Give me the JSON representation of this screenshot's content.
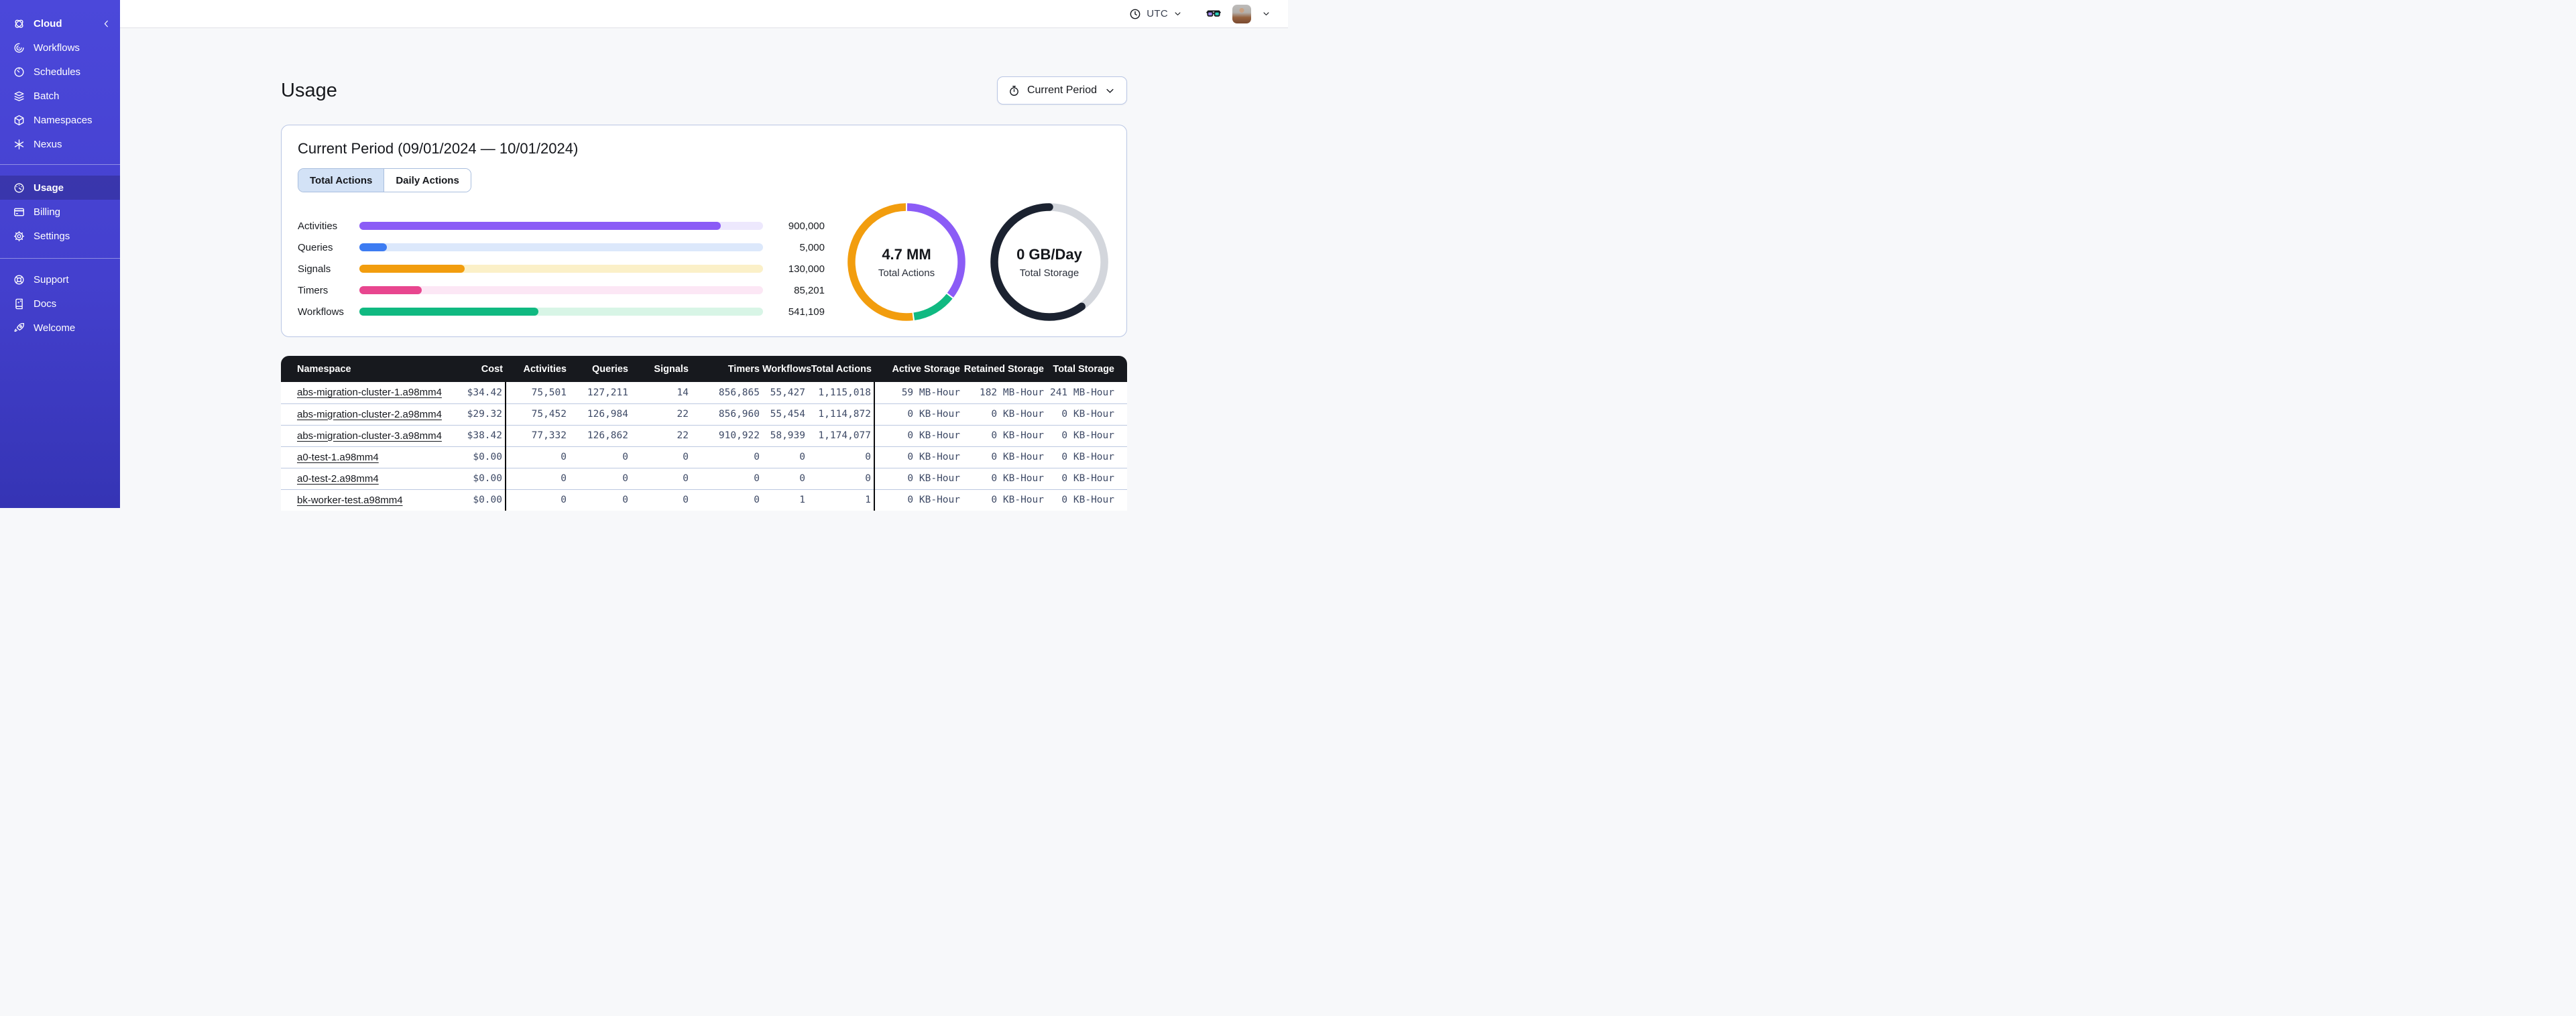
{
  "sidebar": {
    "header": {
      "label": "Cloud",
      "icon": "temporal-logo",
      "collapse_icon": "chevron-left"
    },
    "sections": [
      {
        "items": [
          {
            "label": "Workflows",
            "icon": "workflows"
          },
          {
            "label": "Schedules",
            "icon": "schedules"
          },
          {
            "label": "Batch",
            "icon": "batch"
          },
          {
            "label": "Namespaces",
            "icon": "namespaces"
          },
          {
            "label": "Nexus",
            "icon": "nexus"
          }
        ]
      },
      {
        "items": [
          {
            "label": "Usage",
            "icon": "usage",
            "active": true
          },
          {
            "label": "Billing",
            "icon": "billing"
          },
          {
            "label": "Settings",
            "icon": "settings"
          }
        ]
      },
      {
        "items": [
          {
            "label": "Support",
            "icon": "support"
          },
          {
            "label": "Docs",
            "icon": "docs"
          },
          {
            "label": "Welcome",
            "icon": "welcome"
          }
        ]
      }
    ]
  },
  "topbar": {
    "timezone": "UTC"
  },
  "page": {
    "title": "Usage"
  },
  "period_button": {
    "label": "Current Period"
  },
  "card": {
    "title": "Current Period (09/01/2024 — 10/01/2024)",
    "tabs": [
      {
        "label": "Total Actions",
        "active": true
      },
      {
        "label": "Daily Actions",
        "active": false
      }
    ]
  },
  "chart_data": [
    {
      "type": "bar",
      "title": "Actions by type (current period)",
      "categories": [
        "Activities",
        "Queries",
        "Signals",
        "Timers",
        "Workflows"
      ],
      "values": [
        900000,
        5000,
        130000,
        85201,
        541109
      ],
      "value_labels": [
        "900,000",
        "5,000",
        "130,000",
        "85,201",
        "541,109"
      ],
      "fill_pct": [
        89.5,
        6.8,
        26,
        15.5,
        44.3
      ],
      "colors": [
        "#8B5CF6",
        "#3D7CF2",
        "#F29D0E",
        "#E8468F",
        "#10B981"
      ],
      "track_colors": [
        "#EDE8FD",
        "#DCE8FB",
        "#FBF0C8",
        "#FCE7F5",
        "#D8F5E6"
      ],
      "grid": false,
      "legend": "none"
    },
    {
      "type": "donut",
      "center_value": "4.7 MM",
      "center_label": "Total Actions",
      "segments": [
        {
          "color": "#8B5CF6",
          "pct": 35.5
        },
        {
          "color": "#10B981",
          "pct": 12.5
        },
        {
          "color": "#F29D0E",
          "pct": 52
        }
      ]
    },
    {
      "type": "donut",
      "center_value": "0 GB/Day",
      "center_label": "Total Storage",
      "segments": [
        {
          "color": "#D3D6DC",
          "pct": 40
        },
        {
          "color": "#1B2230",
          "pct": 60,
          "rounded_caps": true
        }
      ]
    }
  ],
  "table": {
    "columns": [
      "Namespace",
      "Cost",
      "Activities",
      "Queries",
      "Signals",
      "Timers",
      "Workflows",
      "Total Actions",
      "Active Storage",
      "Retained Storage",
      "Total Storage"
    ],
    "rows": [
      [
        "abs-migration-cluster-1.a98mm4",
        "$34.42",
        "75,501",
        "127,211",
        "14",
        "856,865",
        "55,427",
        "1,115,018",
        "59 MB-Hour",
        "182 MB-Hour",
        "241 MB-Hour"
      ],
      [
        "abs-migration-cluster-2.a98mm4",
        "$29.32",
        "75,452",
        "126,984",
        "22",
        "856,960",
        "55,454",
        "1,114,872",
        "0 KB-Hour",
        "0 KB-Hour",
        "0 KB-Hour"
      ],
      [
        "abs-migration-cluster-3.a98mm4",
        "$38.42",
        "77,332",
        "126,862",
        "22",
        "910,922",
        "58,939",
        "1,174,077",
        "0 KB-Hour",
        "0 KB-Hour",
        "0 KB-Hour"
      ],
      [
        "a0-test-1.a98mm4",
        "$0.00",
        "0",
        "0",
        "0",
        "0",
        "0",
        "0",
        "0 KB-Hour",
        "0 KB-Hour",
        "0 KB-Hour"
      ],
      [
        "a0-test-2.a98mm4",
        "$0.00",
        "0",
        "0",
        "0",
        "0",
        "0",
        "0",
        "0 KB-Hour",
        "0 KB-Hour",
        "0 KB-Hour"
      ],
      [
        "bk-worker-test.a98mm4",
        "$0.00",
        "0",
        "0",
        "0",
        "0",
        "1",
        "1",
        "0 KB-Hour",
        "0 KB-Hour",
        "0 KB-Hour"
      ]
    ]
  }
}
